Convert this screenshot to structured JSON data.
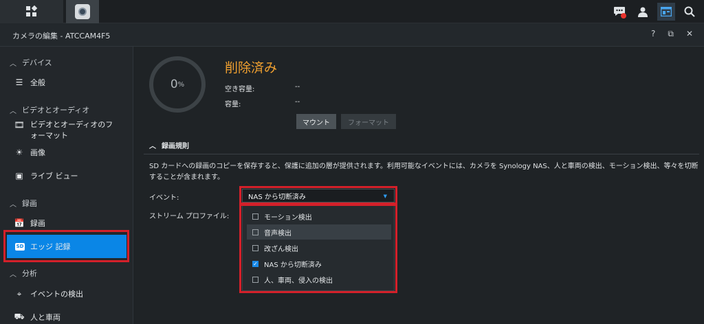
{
  "topbar": {
    "icons": [
      "grid-icon",
      "camera-icon",
      "chat-icon",
      "user-icon",
      "window-icon",
      "search-icon"
    ]
  },
  "window": {
    "title": "カメラの編集 - ATCCAM4F5",
    "help": "?",
    "restore": "⧉",
    "close": "✕"
  },
  "sidebar": {
    "sections": [
      {
        "label": "デバイス"
      },
      {
        "label": "ビデオとオーディオ"
      },
      {
        "label": "録画"
      },
      {
        "label": "分析"
      }
    ],
    "items": [
      {
        "label": "全般"
      },
      {
        "label": "ビデオとオーディオのフォーマット"
      },
      {
        "label": "画像"
      },
      {
        "label": "ライブ ビュー"
      },
      {
        "label": "録画"
      },
      {
        "label": "エッジ 記録"
      },
      {
        "label": "イベントの検出"
      },
      {
        "label": "人と車両"
      }
    ]
  },
  "storage": {
    "percent": "0",
    "percent_unit": "%",
    "status": "削除済み",
    "free_label": "空き容量:",
    "free_value": "--",
    "capacity_label": "容量:",
    "capacity_value": "--",
    "mount_label": "マウント",
    "format_label": "フォーマット"
  },
  "rules": {
    "header": "録画規則",
    "description": "SD カードへの録画のコピーを保存すると、保護に追加の層が提供されます。利用可能なイベントには、カメラを Synology NAS、人と車両の検出、モーション検出、等々を切断することが含まれます。",
    "event_label": "イベント:",
    "event_value": "NAS から切断済み",
    "stream_label": "ストリーム プロファイル:",
    "options": [
      {
        "label": "モーション検出",
        "checked": false
      },
      {
        "label": "音声検出",
        "checked": false
      },
      {
        "label": "改ざん検出",
        "checked": false
      },
      {
        "label": "NAS から切断済み",
        "checked": true
      },
      {
        "label": "人、車両、侵入の検出",
        "checked": false
      }
    ]
  }
}
